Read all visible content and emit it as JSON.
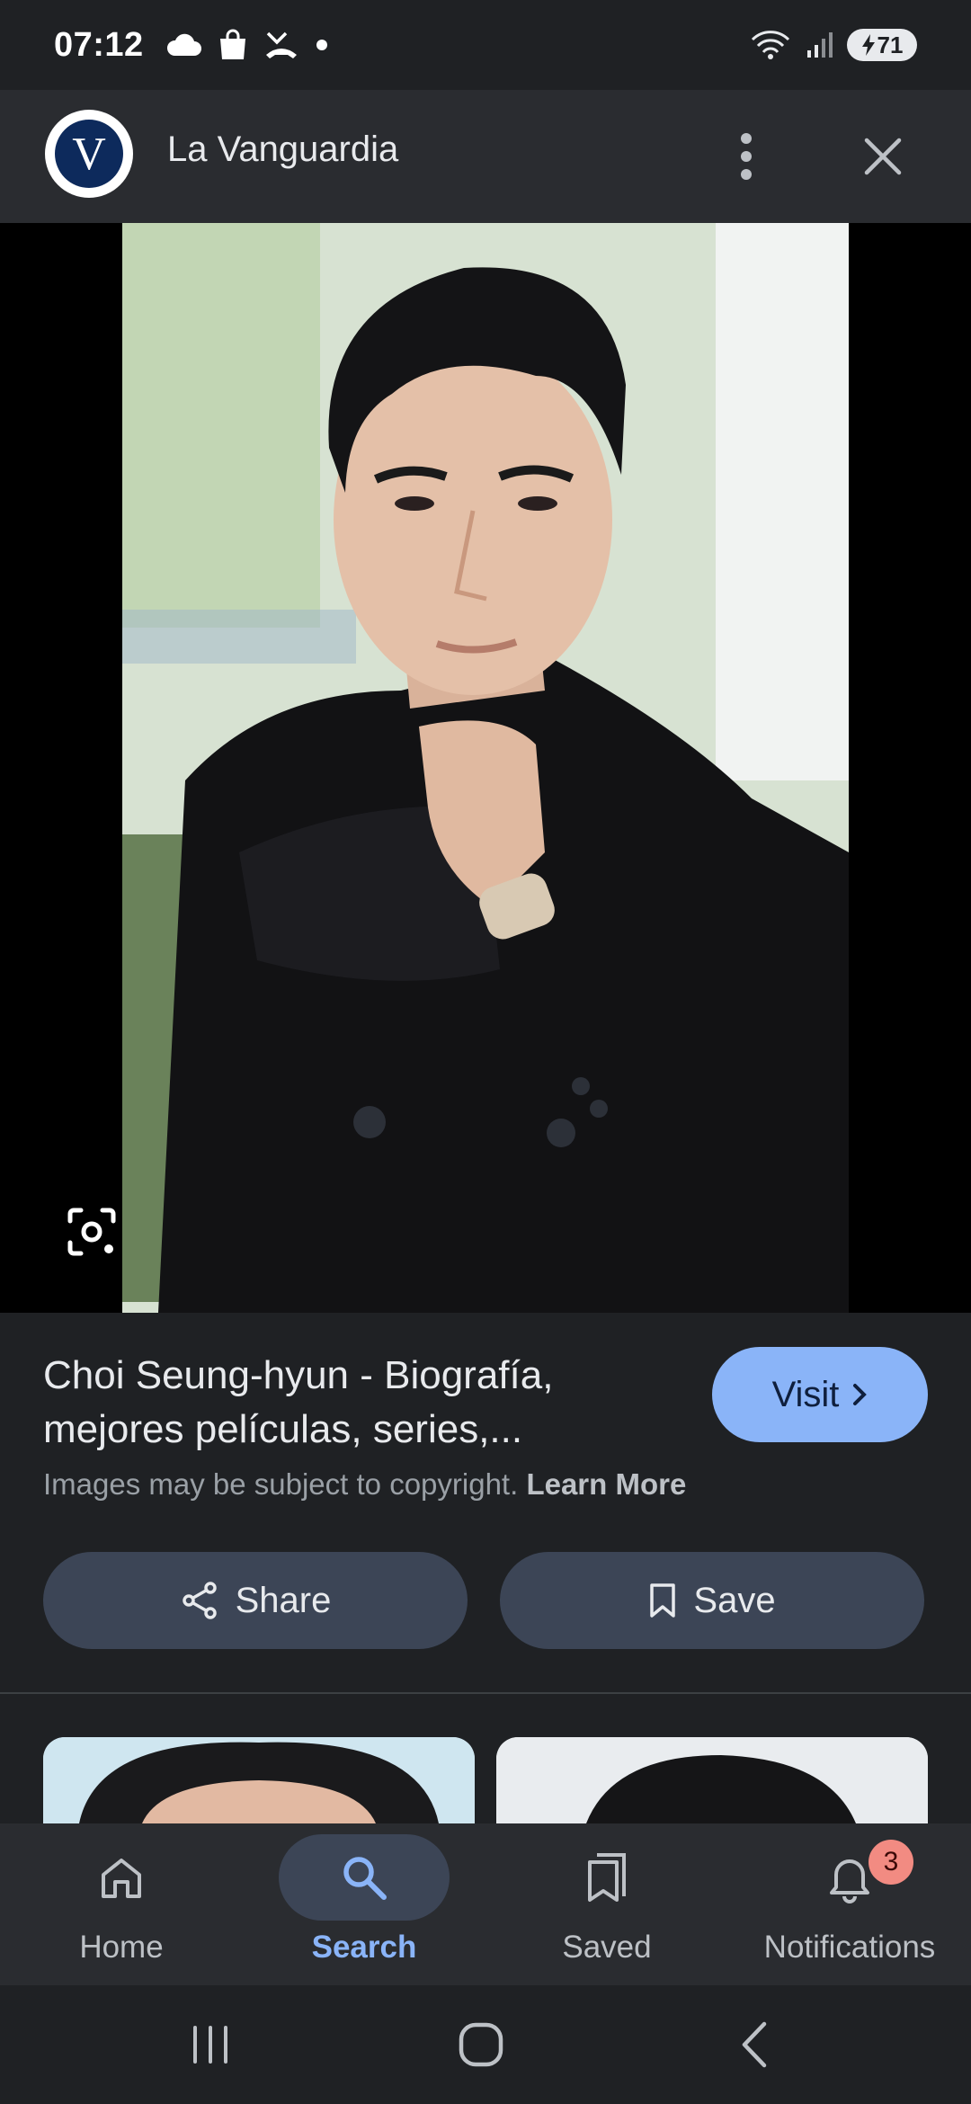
{
  "status_bar": {
    "time": "07:12",
    "battery": "71"
  },
  "header": {
    "logo_letter": "V",
    "site_name": "La Vanguardia"
  },
  "result": {
    "title": "Choi Seung-hyun - Biografía, mejores películas, series,...",
    "visit_label": "Visit",
    "copyright_text": "Images may be subject to copyright.",
    "learn_more": "Learn More",
    "share_label": "Share",
    "save_label": "Save"
  },
  "bottom_nav": {
    "items": [
      {
        "label": "Home",
        "icon": "home-icon"
      },
      {
        "label": "Search",
        "icon": "search-icon"
      },
      {
        "label": "Saved",
        "icon": "saved-icon"
      },
      {
        "label": "Notifications",
        "icon": "bell-icon"
      }
    ],
    "active": "Search",
    "notification_count": "3"
  },
  "colors": {
    "background": "#1f2124",
    "accent": "#8ab4f8",
    "button_bg": "#3c4556",
    "badge": "#f28b82"
  }
}
